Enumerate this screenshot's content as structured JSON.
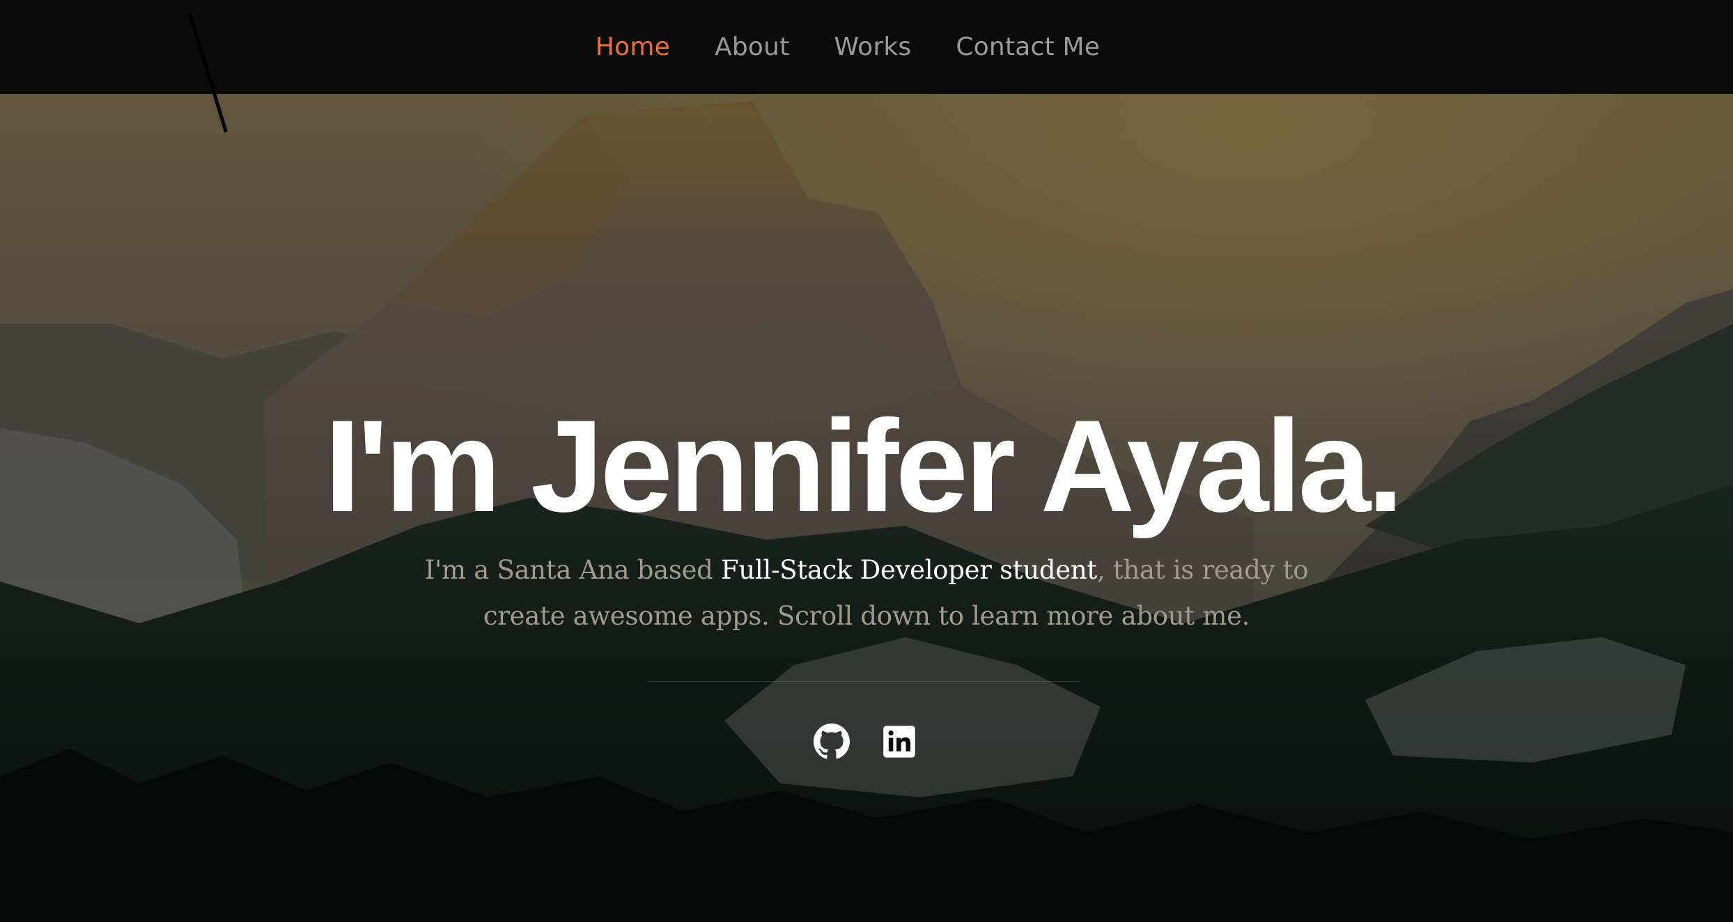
{
  "nav": {
    "items": [
      {
        "label": "Home",
        "active": true
      },
      {
        "label": "About",
        "active": false
      },
      {
        "label": "Works",
        "active": false
      },
      {
        "label": "Contact Me",
        "active": false
      }
    ],
    "active_color": "#ef7035",
    "text_color": "#9a9a9a"
  },
  "hero": {
    "title": "I'm Jennifer Ayala.",
    "description": {
      "before": "I'm a Santa Ana based ",
      "highlight": "Full-Stack Developer student",
      "after": ", that is ready to create awesome apps. Scroll down to learn more about me."
    },
    "social": [
      {
        "name": "github",
        "icon": "github-icon"
      },
      {
        "name": "linkedin",
        "icon": "linkedin-icon"
      }
    ]
  }
}
